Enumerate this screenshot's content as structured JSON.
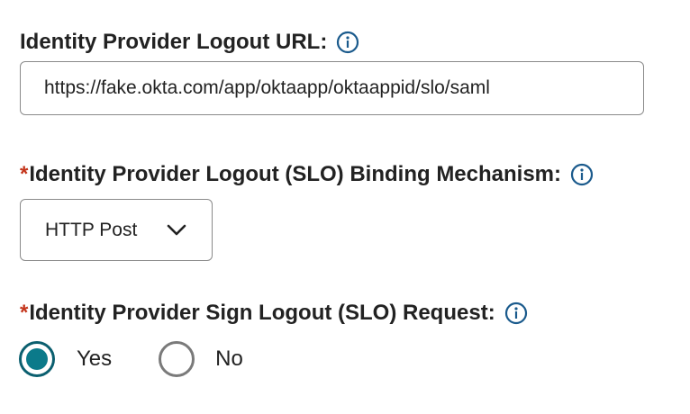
{
  "logout_url": {
    "label": "Identity Provider Logout URL:",
    "value": "https://fake.okta.com/app/oktaapp/oktaappid/slo/saml"
  },
  "binding_mechanism": {
    "required_marker": "*",
    "label": "Identity Provider Logout (SLO) Binding Mechanism:",
    "selected": "HTTP Post"
  },
  "sign_request": {
    "required_marker": "*",
    "label": "Identity Provider Sign Logout (SLO) Request:",
    "options": [
      {
        "label": "Yes",
        "checked": true
      },
      {
        "label": "No",
        "checked": false
      }
    ]
  },
  "icons": {
    "info": "info-circle-icon",
    "dropdown": "chevron-down-icon"
  },
  "colors": {
    "accent": "#0b7a8a",
    "info_icon": "#1a5a8c",
    "required": "#c4351b"
  }
}
